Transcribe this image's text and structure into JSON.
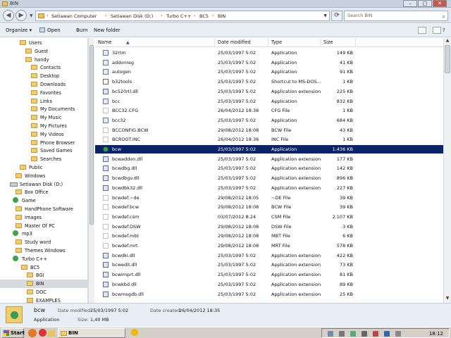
{
  "window": {
    "title": "BIN"
  },
  "address": {
    "crumbs": [
      "Setiawan Computer",
      "Setiawan Disk (D:)",
      "Turbo C++",
      "BC5",
      "BIN"
    ],
    "search_placeholder": "Search BIN"
  },
  "toolbar": {
    "organize": "Organize",
    "open": "Open",
    "burn": "Burn",
    "new_folder": "New folder"
  },
  "nav": {
    "items": [
      {
        "label": "Users",
        "kind": "folder"
      },
      {
        "label": "Guest",
        "kind": "folder"
      },
      {
        "label": "handy",
        "kind": "folder"
      },
      {
        "label": "Contacts",
        "kind": "folder"
      },
      {
        "label": "Desktop",
        "kind": "folder"
      },
      {
        "label": "Downloads",
        "kind": "folder"
      },
      {
        "label": "Favorites",
        "kind": "folder"
      },
      {
        "label": "Links",
        "kind": "folder"
      },
      {
        "label": "My Documents",
        "kind": "folder"
      },
      {
        "label": "My Music",
        "kind": "folder"
      },
      {
        "label": "My Pictures",
        "kind": "folder"
      },
      {
        "label": "My Videos",
        "kind": "folder"
      },
      {
        "label": "Phone Browser",
        "kind": "folder"
      },
      {
        "label": "Saved Games",
        "kind": "folder"
      },
      {
        "label": "Searches",
        "kind": "folder"
      },
      {
        "label": "Public",
        "kind": "folder"
      },
      {
        "label": "Windows",
        "kind": "folder"
      },
      {
        "label": "Setiawan Disk (D:)",
        "kind": "drive"
      },
      {
        "label": "Box Office",
        "kind": "folder"
      },
      {
        "label": "Game",
        "kind": "app"
      },
      {
        "label": "HandPhone Software",
        "kind": "folder"
      },
      {
        "label": "Images",
        "kind": "folder"
      },
      {
        "label": "Master Of PC",
        "kind": "folder"
      },
      {
        "label": "mp3",
        "kind": "app"
      },
      {
        "label": "Study word",
        "kind": "folder"
      },
      {
        "label": "Themes Windows",
        "kind": "folder"
      },
      {
        "label": "Turbo C++",
        "kind": "app"
      },
      {
        "label": "BC5",
        "kind": "folder"
      },
      {
        "label": "BGI",
        "kind": "folder"
      },
      {
        "label": "BIN",
        "kind": "folder",
        "selected": true
      },
      {
        "label": "DOC",
        "kind": "folder"
      },
      {
        "label": "EXAMPLES",
        "kind": "folder"
      }
    ]
  },
  "columns": {
    "name": "Name",
    "date": "Date modified",
    "type": "Type",
    "size": "Size"
  },
  "files": [
    {
      "name": "32rtm",
      "date": "25/03/1997 5:02",
      "type": "Application",
      "size": "149 KB",
      "icon": "app"
    },
    {
      "name": "addonreg",
      "date": "25/03/1997 5:02",
      "type": "Application",
      "size": "41 KB",
      "icon": "app"
    },
    {
      "name": "autogen",
      "date": "25/03/1997 5:02",
      "type": "Application",
      "size": "91 KB",
      "icon": "app"
    },
    {
      "name": "b32tools",
      "date": "25/03/1997 5:02",
      "type": "Shortcut to MS-DOS...",
      "size": "1 KB",
      "icon": "sc"
    },
    {
      "name": "bc520rtl.dll",
      "date": "25/03/1997 5:02",
      "type": "Application extension",
      "size": "225 KB",
      "icon": "gear"
    },
    {
      "name": "bcc",
      "date": "25/03/1997 5:02",
      "type": "Application",
      "size": "832 KB",
      "icon": "app"
    },
    {
      "name": "BCC32.CFG",
      "date": "26/04/2012 18:36",
      "type": "CFG File",
      "size": "1 KB",
      "icon": "cfg"
    },
    {
      "name": "bcc32",
      "date": "25/03/1997 5:02",
      "type": "Application",
      "size": "684 KB",
      "icon": "app"
    },
    {
      "name": "BCCONFIG.BCW",
      "date": "29/08/2012 18:08",
      "type": "BCW File",
      "size": "43 KB",
      "icon": "cfg"
    },
    {
      "name": "BCROOT.INC",
      "date": "26/04/2012 18:36",
      "type": "INC File",
      "size": "1 KB",
      "icon": "cfg"
    },
    {
      "name": "bcw",
      "date": "25/03/1997 5:02",
      "type": "Application",
      "size": "1.436 KB",
      "icon": "bcw",
      "selected": true
    },
    {
      "name": "bcwaddon.dll",
      "date": "25/03/1997 5:02",
      "type": "Application extension",
      "size": "177 KB",
      "icon": "gear"
    },
    {
      "name": "bcwdbg.dll",
      "date": "25/03/1997 5:02",
      "type": "Application extension",
      "size": "142 KB",
      "icon": "gear"
    },
    {
      "name": "bcwdbgv.dll",
      "date": "25/03/1997 5:02",
      "type": "Application extension",
      "size": "896 KB",
      "icon": "gear"
    },
    {
      "name": "bcwdbk32.dll",
      "date": "25/03/1997 5:02",
      "type": "Application extension",
      "size": "227 KB",
      "icon": "gear"
    },
    {
      "name": "bcwdef.~de",
      "date": "29/08/2012 18:05",
      "type": "~DE File",
      "size": "39 KB",
      "icon": "cfg"
    },
    {
      "name": "bcwdef.bcw",
      "date": "29/08/2012 18:08",
      "type": "BCW File",
      "size": "39 KB",
      "icon": "cfg"
    },
    {
      "name": "bcwdef.csm",
      "date": "03/07/2012 8:24",
      "type": "CSM File",
      "size": "2.107 KB",
      "icon": "cfg"
    },
    {
      "name": "bcwdef.DSW",
      "date": "29/08/2012 18:08",
      "type": "DSW File",
      "size": "3 KB",
      "icon": "cfg"
    },
    {
      "name": "bcwdef.mbt",
      "date": "29/08/2012 18:08",
      "type": "MBT File",
      "size": "6 KB",
      "icon": "cfg"
    },
    {
      "name": "bcwdef.mrt",
      "date": "29/08/2012 18:08",
      "type": "MRT File",
      "size": "578 KB",
      "icon": "cfg"
    },
    {
      "name": "bcwdki.dll",
      "date": "25/03/1997 5:02",
      "type": "Application extension",
      "size": "422 KB",
      "icon": "gear"
    },
    {
      "name": "bcwedit.dll",
      "date": "25/03/1997 5:02",
      "type": "Application extension",
      "size": "73 KB",
      "icon": "gear"
    },
    {
      "name": "bcwimprt.dll",
      "date": "25/03/1997 5:02",
      "type": "Application extension",
      "size": "81 KB",
      "icon": "gear"
    },
    {
      "name": "bcwkbd.dll",
      "date": "25/03/1997 5:02",
      "type": "Application extension",
      "size": "89 KB",
      "icon": "gear"
    },
    {
      "name": "bcwmsgdb.dll",
      "date": "25/03/1997 5:02",
      "type": "Application extension",
      "size": "25 KB",
      "icon": "gear"
    }
  ],
  "details": {
    "name": "bcw",
    "type": "Application",
    "modified_label": "Date modified:",
    "modified": "25/03/1997 5:02",
    "created_label": "Date created:",
    "created": "26/04/2012 18:35",
    "size_label": "Size:",
    "size": "1,40 MB"
  },
  "taskbar": {
    "start": "Start",
    "task": "BIN",
    "clock": "18:12"
  }
}
